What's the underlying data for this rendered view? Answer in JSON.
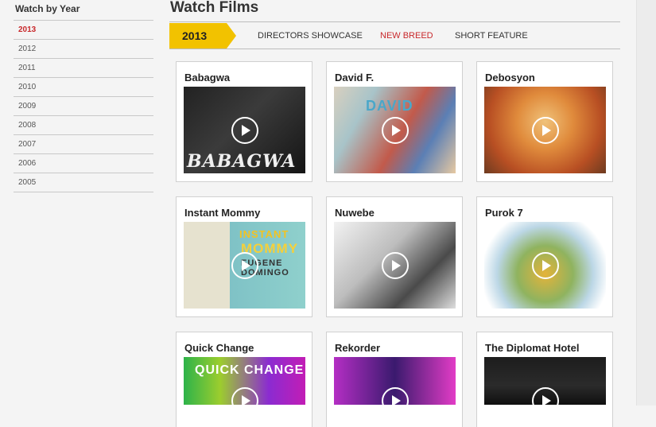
{
  "sidebar": {
    "heading": "Watch by Year",
    "years": [
      "2013",
      "2012",
      "2011",
      "2010",
      "2009",
      "2008",
      "2007",
      "2006",
      "2005"
    ],
    "active_year": "2013"
  },
  "main": {
    "title": "Watch Films",
    "tabs": {
      "year": "2013",
      "directors": "DIRECTORS SHOWCASE",
      "new_breed": "NEW BREED",
      "short_feature": "SHORT FEATURE"
    },
    "films": [
      {
        "title": "Babagwa",
        "art_text": "BABAGWA"
      },
      {
        "title": "David F.",
        "art_text": "DAVID"
      },
      {
        "title": "Debosyon"
      },
      {
        "title": "Instant Mommy",
        "art_text": [
          "INSTANT",
          "MOMMY",
          "EUGENE DOMINGO"
        ]
      },
      {
        "title": "Nuwebe"
      },
      {
        "title": "Purok 7"
      },
      {
        "title": "Quick Change",
        "art_text": "QUICK CHANGE"
      },
      {
        "title": "Rekorder"
      },
      {
        "title": "The Diplomat Hotel"
      }
    ]
  },
  "colors": {
    "accent_red": "#c8282b",
    "tab_yellow": "#f2c200",
    "page_bg": "#f4f4f4"
  },
  "icons": {
    "play": "play-circle-icon"
  }
}
